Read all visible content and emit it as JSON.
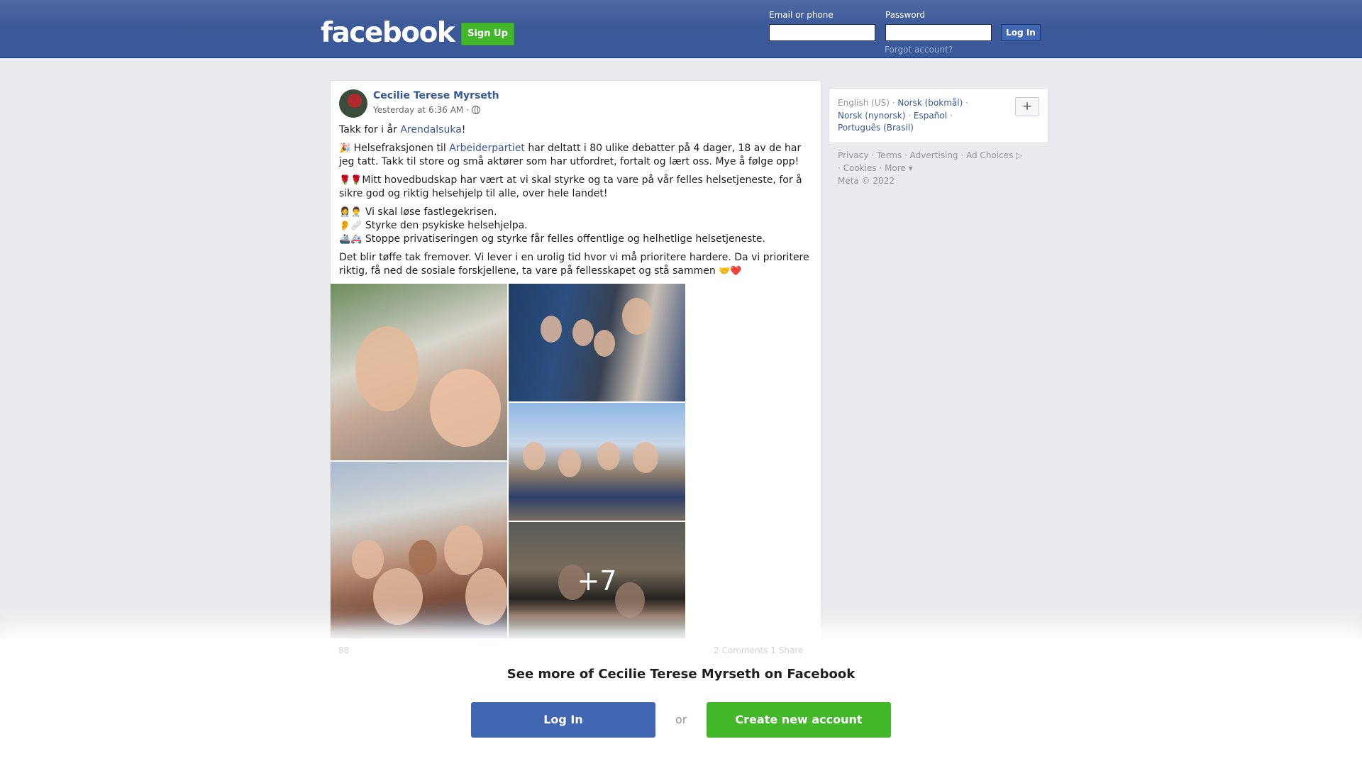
{
  "header": {
    "logo": "facebook",
    "signup_label": "Sign Up",
    "email_label": "Email or phone",
    "password_label": "Password",
    "login_label": "Log In",
    "forgot_label": "Forgot account?"
  },
  "post": {
    "author": "Cecilie Terese Myrseth",
    "timestamp": "Yesterday at 6:36 AM ·",
    "line1_prefix": "Takk for i år ",
    "line1_link": "Arendalsuka",
    "line1_suffix": "!",
    "p2_emoji": "🎉",
    "p2_prefix": " Helsefraksjonen til ",
    "p2_link": "Arbeiderpartiet",
    "p2_suffix": " har deltatt i 80 ulike debatter på 4 dager, 18 av de har jeg tatt. Takk til store og små aktører som har utfordret, fortalt og lært oss. Mye å følge opp!",
    "p3_emoji": "🌹🌹",
    "p3_text": "Mitt hovedbudskap har vært at vi skal styrke og ta vare på vår felles helsetjeneste, for å sikre god og riktig helsehjelp til alle, over hele landet!",
    "bullet1_emoji": "👩‍⚕️👨‍⚕️",
    "bullet1_text": " Vi skal løse fastlegekrisen.",
    "bullet2_emoji": "👂🩹",
    "bullet2_text": " Styrke den psykiske helsehjelpa.",
    "bullet3_emoji": "🚢🚑",
    "bullet3_text": " Stoppe privatiseringen og styrke får felles offentlige og helhetlige helsetjeneste.",
    "p5_text": "Det blir tøffe tak fremover. Vi lever i en urolig tid hvor vi må prioritere hardere. Da vi prioritere riktig, få ned de sosiale forskjellene, ta vare på fellesskapet og stå sammen ",
    "p5_emoji": "🤝❤️",
    "more_photos": "+7",
    "reactions_count": "88",
    "comments_shares": "2 Comments  1 Share"
  },
  "sidebar": {
    "lang_current": "English (US) · ",
    "lang_links": [
      "Norsk (bokmål)",
      "Norsk (nynorsk)",
      "Español",
      "Português (Brasil)"
    ],
    "lang_plus": "+",
    "footer_line1": "Privacy · Terms · Advertising · Ad Choices ▷",
    "footer_line2": "· Cookies · More ▾",
    "footer_line3": "Meta © 2022"
  },
  "overlay": {
    "see_more": "See more of Cecilie Terese Myrseth on Facebook",
    "login_label": "Log In",
    "or_label": "or",
    "create_label": "Create new account"
  }
}
